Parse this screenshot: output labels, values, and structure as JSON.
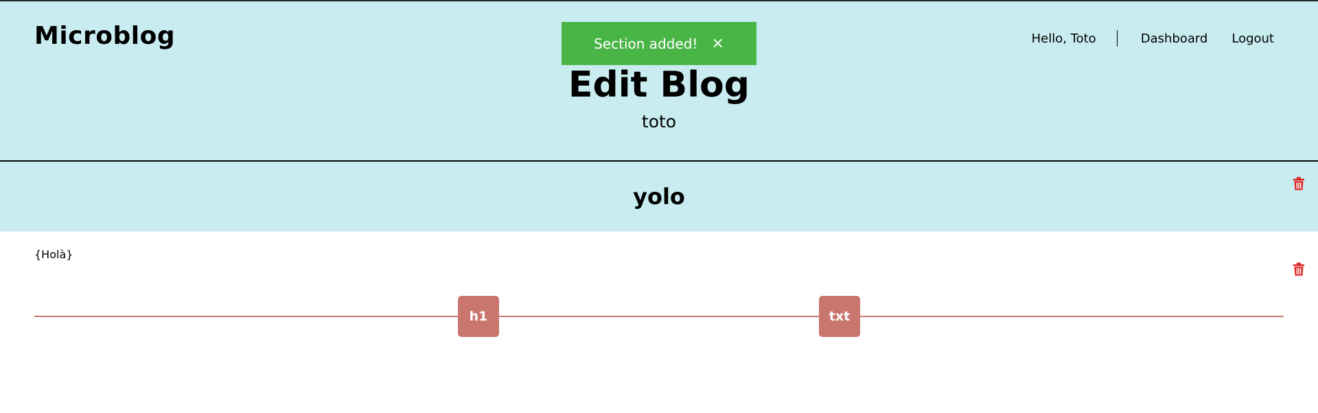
{
  "header": {
    "brand": "Microblog",
    "nav": {
      "greeting": "Hello, Toto",
      "dashboard": "Dashboard",
      "logout": "Logout"
    },
    "title": "Edit Blog",
    "subtitle": "toto"
  },
  "toast": {
    "message": "Section added!",
    "close": "×"
  },
  "sections": [
    {
      "type": "h1",
      "content": "yolo"
    },
    {
      "type": "txt",
      "content": "{Holà}"
    }
  ],
  "add_buttons": {
    "h1": "h1",
    "txt": "txt"
  },
  "icons": {
    "delete": "trash-icon"
  },
  "colors": {
    "header_bg": "#c8ecf0",
    "toast_bg": "#4ab547",
    "accent": "#c9766e",
    "delete": "#e02020"
  }
}
